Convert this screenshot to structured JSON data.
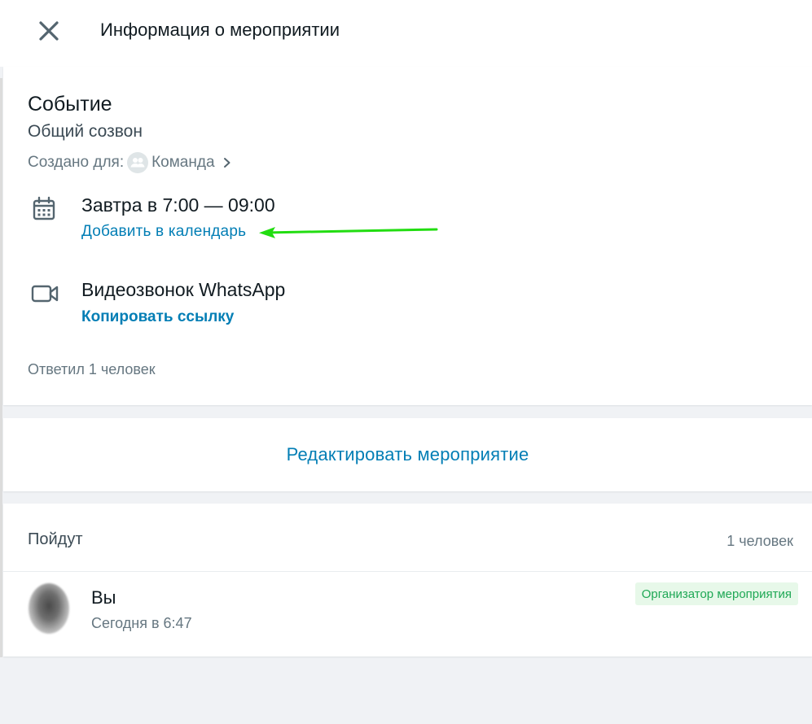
{
  "header": {
    "title": "Информация о мероприятии"
  },
  "event": {
    "type_label": "Событие",
    "name": "Общий созвон",
    "created_for_label": "Создано для:",
    "group_name": "Команда",
    "time": "Завтра в 7:00 — 09:00",
    "add_to_calendar": "Добавить в календарь",
    "call_type": "Видеозвонок WhatsApp",
    "copy_link": "Копировать ссылку",
    "responded": "Ответил 1 человек"
  },
  "edit": {
    "label": "Редактировать мероприятие"
  },
  "going": {
    "title": "Пойдут",
    "count": "1 человек",
    "members": [
      {
        "name": "Вы",
        "time": "Сегодня в 6:47",
        "badge": "Организатор мероприятия"
      }
    ]
  },
  "colors": {
    "link": "#027eb5",
    "badge_bg": "#e7f8e9",
    "badge_text": "#1fa855",
    "annotation_arrow": "#22dd11",
    "background": "#f0f2f5"
  },
  "icons": {
    "close": "close-icon",
    "group": "group-icon",
    "chevron": "chevron-right-icon",
    "calendar": "calendar-icon",
    "video": "video-camera-icon"
  }
}
